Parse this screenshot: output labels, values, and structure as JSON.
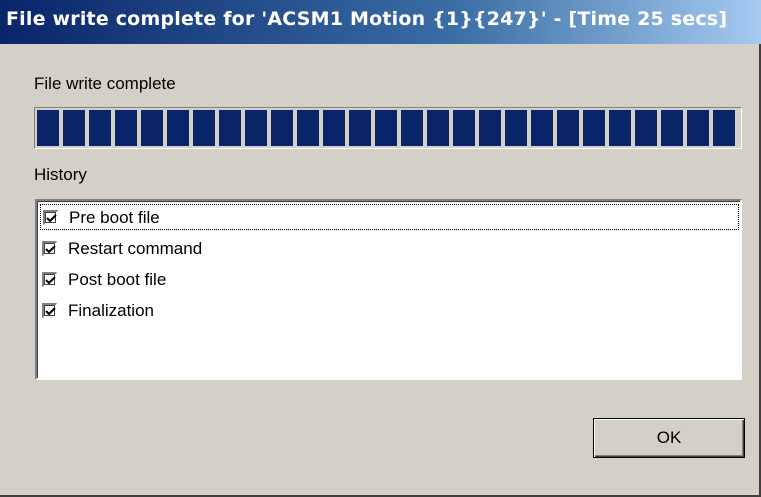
{
  "window": {
    "title": "File write complete for 'ACSM1 Motion {1}{247}' - [Time 25 secs]"
  },
  "status": {
    "label": "File write complete",
    "progress_percent": 100
  },
  "history": {
    "label": "History",
    "items": [
      {
        "label": "Pre boot file",
        "checked": true
      },
      {
        "label": "Restart command",
        "checked": true
      },
      {
        "label": "Post boot file",
        "checked": true
      },
      {
        "label": "Finalization",
        "checked": true
      }
    ]
  },
  "buttons": {
    "ok_label": "OK"
  },
  "colors": {
    "title_bar_start": "#0a246a",
    "title_bar_end": "#a6caf0",
    "progress_fill": "#0a246a",
    "dialog_background": "#d4d0c8"
  }
}
